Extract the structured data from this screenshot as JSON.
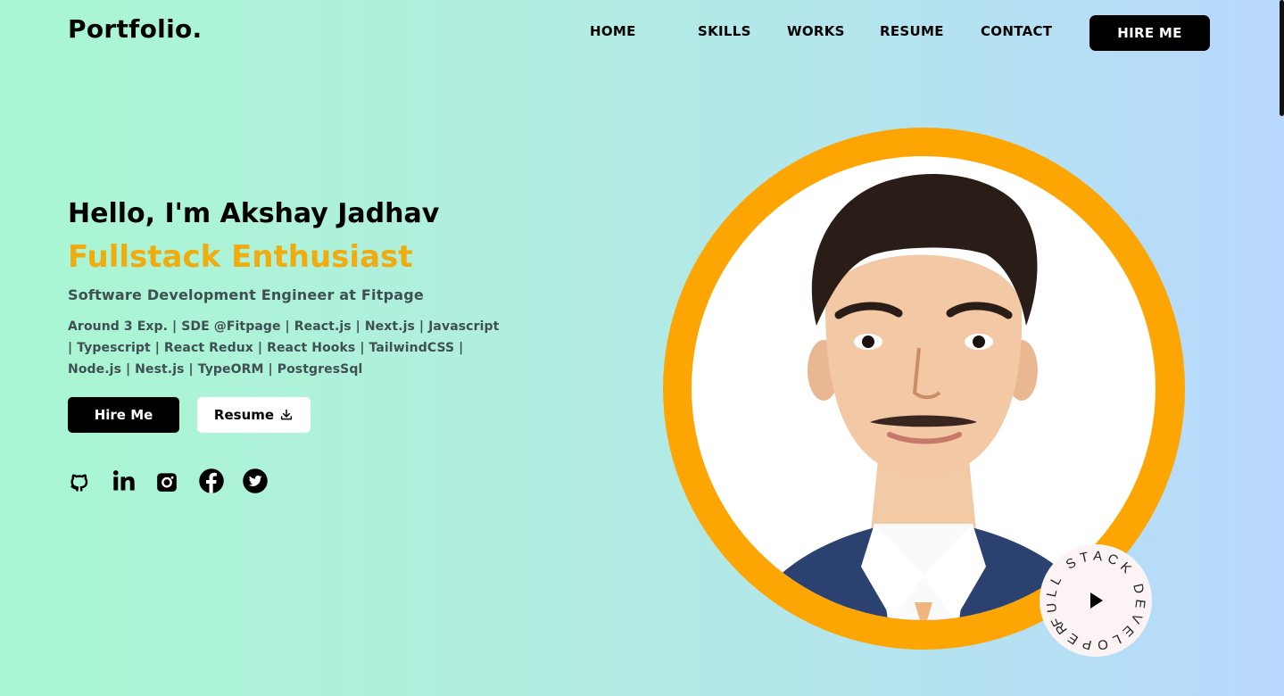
{
  "brand": {
    "logo": "Portfolio."
  },
  "nav": {
    "home": "HOME",
    "skills": "SKILLS",
    "works": "WORKS",
    "resume": "RESUME",
    "contact": "CONTACT",
    "hire": "HIRE ME"
  },
  "hero": {
    "greeting": "Hello, I'm Akshay Jadhav",
    "role": "Fullstack Enthusiast",
    "subtitle": "Software Development Engineer at Fitpage",
    "description": "Around 3 Exp. | SDE @Fitpage | React.js | Next.js | Javascript | Typescript | React Redux | React Hooks | TailwindCSS | Node.js | Nest.js | TypeORM | PostgresSql",
    "hire_button": "Hire Me",
    "resume_button": "Resume"
  },
  "socials": [
    {
      "icon": "github-icon"
    },
    {
      "icon": "linkedin-icon"
    },
    {
      "icon": "instagram-icon"
    },
    {
      "icon": "facebook-icon"
    },
    {
      "icon": "twitter-icon"
    }
  ],
  "badge": {
    "circular_text": "FULL STACK DEVELOPER •",
    "icon": "play-icon"
  },
  "colors": {
    "accent": "#f0ab0e",
    "ring": "#fda503",
    "dark": "#000000",
    "muted_text": "#3f4f52"
  }
}
